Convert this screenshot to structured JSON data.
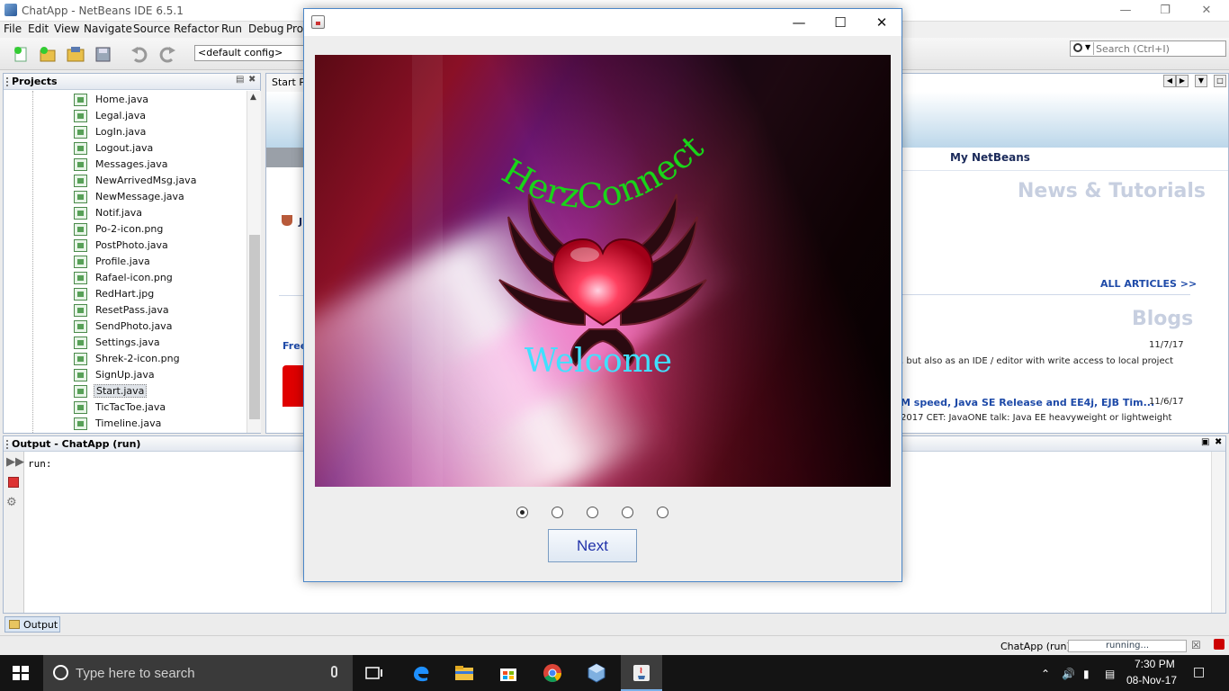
{
  "ide": {
    "title": "ChatApp - NetBeans IDE 6.5.1",
    "menu": [
      "File",
      "Edit",
      "View",
      "Navigate",
      "Source",
      "Refactor",
      "Run",
      "Debug",
      "Pro"
    ],
    "config": "<default config>",
    "search_placeholder": "Search (Ctrl+I)"
  },
  "projects": {
    "title": "Projects",
    "files": [
      "Home.java",
      "Legal.java",
      "LogIn.java",
      "Logout.java",
      "Messages.java",
      "NewArrivedMsg.java",
      "NewMessage.java",
      "Notif.java",
      "Po-2-icon.png",
      "PostPhoto.java",
      "Profile.java",
      "Rafael-icon.png",
      "RedHart.jpg",
      "ResetPass.java",
      "SendPhoto.java",
      "Settings.java",
      "Shrek-2-icon.png",
      "SignUp.java",
      "Start.java",
      "TicTacToe.java",
      "Timeline.java"
    ],
    "selected": "Start.java"
  },
  "start_page": {
    "tab_label": "Start P",
    "my_netbeans": "My NetBeans",
    "news_heading": "News & Tutorials",
    "all_articles": "ALL ARTICLES >>",
    "blogs_heading": "Blogs",
    "j_label": "J",
    "free_label": "Free",
    "blog1_date": "11/7/17",
    "blog1_text": ", but also as an IDE / editor with write access to local project",
    "blog2_title": "M speed, Java SE Release and EE4j, EJB Tim...",
    "blog2_date": "11/6/17",
    "blog2_text": "2017 CET: JavaONE talk: Java EE heavyweight or lightweight"
  },
  "output": {
    "title": "Output - ChatApp (run)",
    "text": "run:",
    "tab_label": "Output"
  },
  "status": {
    "project": "ChatApp (run)",
    "progress": "running..."
  },
  "dialog": {
    "splash_title": "HerzConnect",
    "welcome": "Welcome",
    "steps": 5,
    "current_step": 1,
    "next_label": "Next"
  },
  "taskbar": {
    "search_placeholder": "Type here to search",
    "time": "7:30 PM",
    "date": "08-Nov-17"
  },
  "colors": {
    "accent": "#4a86c8",
    "splash_title": "#19d419",
    "welcome": "#40e0ff",
    "next_text": "#2233aa"
  }
}
